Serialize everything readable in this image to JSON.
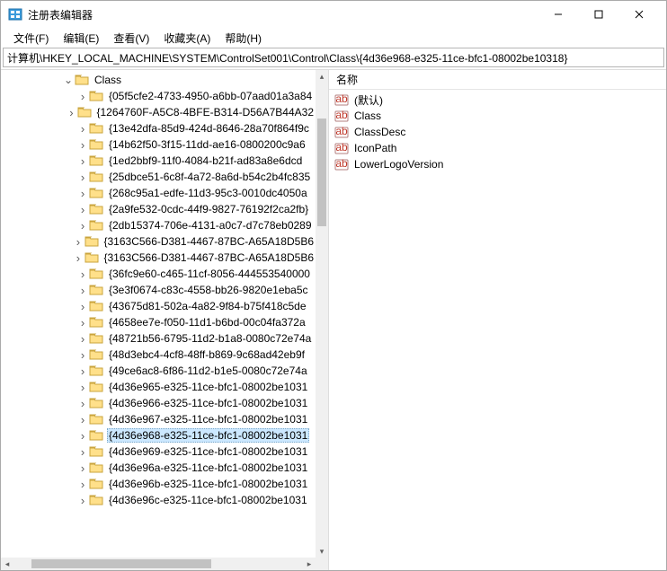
{
  "window": {
    "title": "注册表编辑器"
  },
  "menu": {
    "file": "文件(F)",
    "edit": "编辑(E)",
    "view": "查看(V)",
    "favorites": "收藏夹(A)",
    "help": "帮助(H)"
  },
  "addressbar": {
    "path": "计算机\\HKEY_LOCAL_MACHINE\\SYSTEM\\ControlSet001\\Control\\Class\\{4d36e968-e325-11ce-bfc1-08002be10318}"
  },
  "tree": {
    "parent_label": "Class",
    "selected": "{4d36e968-e325-11ce-bfc1-08002be10318}",
    "items": [
      "{05f5cfe2-4733-4950-a6bb-07aad01a3a84",
      "{1264760F-A5C8-4BFE-B314-D56A7B44A32",
      "{13e42dfa-85d9-424d-8646-28a70f864f9c",
      "{14b62f50-3f15-11dd-ae16-0800200c9a6",
      "{1ed2bbf9-11f0-4084-b21f-ad83a8e6dcd",
      "{25dbce51-6c8f-4a72-8a6d-b54c2b4fc835",
      "{268c95a1-edfe-11d3-95c3-0010dc4050a",
      "{2a9fe532-0cdc-44f9-9827-76192f2ca2fb}",
      "{2db15374-706e-4131-a0c7-d7c78eb0289",
      "{3163C566-D381-4467-87BC-A65A18D5B6",
      "{3163C566-D381-4467-87BC-A65A18D5B6",
      "{36fc9e60-c465-11cf-8056-444553540000",
      "{3e3f0674-c83c-4558-bb26-9820e1eba5c",
      "{43675d81-502a-4a82-9f84-b75f418c5de",
      "{4658ee7e-f050-11d1-b6bd-00c04fa372a",
      "{48721b56-6795-11d2-b1a8-0080c72e74a",
      "{48d3ebc4-4cf8-48ff-b869-9c68ad42eb9f",
      "{49ce6ac8-6f86-11d2-b1e5-0080c72e74a",
      "{4d36e965-e325-11ce-bfc1-08002be1031",
      "{4d36e966-e325-11ce-bfc1-08002be1031",
      "{4d36e967-e325-11ce-bfc1-08002be1031",
      "{4d36e968-e325-11ce-bfc1-08002be1031",
      "{4d36e969-e325-11ce-bfc1-08002be1031",
      "{4d36e96a-e325-11ce-bfc1-08002be1031",
      "{4d36e96b-e325-11ce-bfc1-08002be1031",
      "{4d36e96c-e325-11ce-bfc1-08002be1031"
    ]
  },
  "list": {
    "header_name": "名称",
    "rows": [
      "(默认)",
      "Class",
      "ClassDesc",
      "IconPath",
      "LowerLogoVersion"
    ]
  }
}
